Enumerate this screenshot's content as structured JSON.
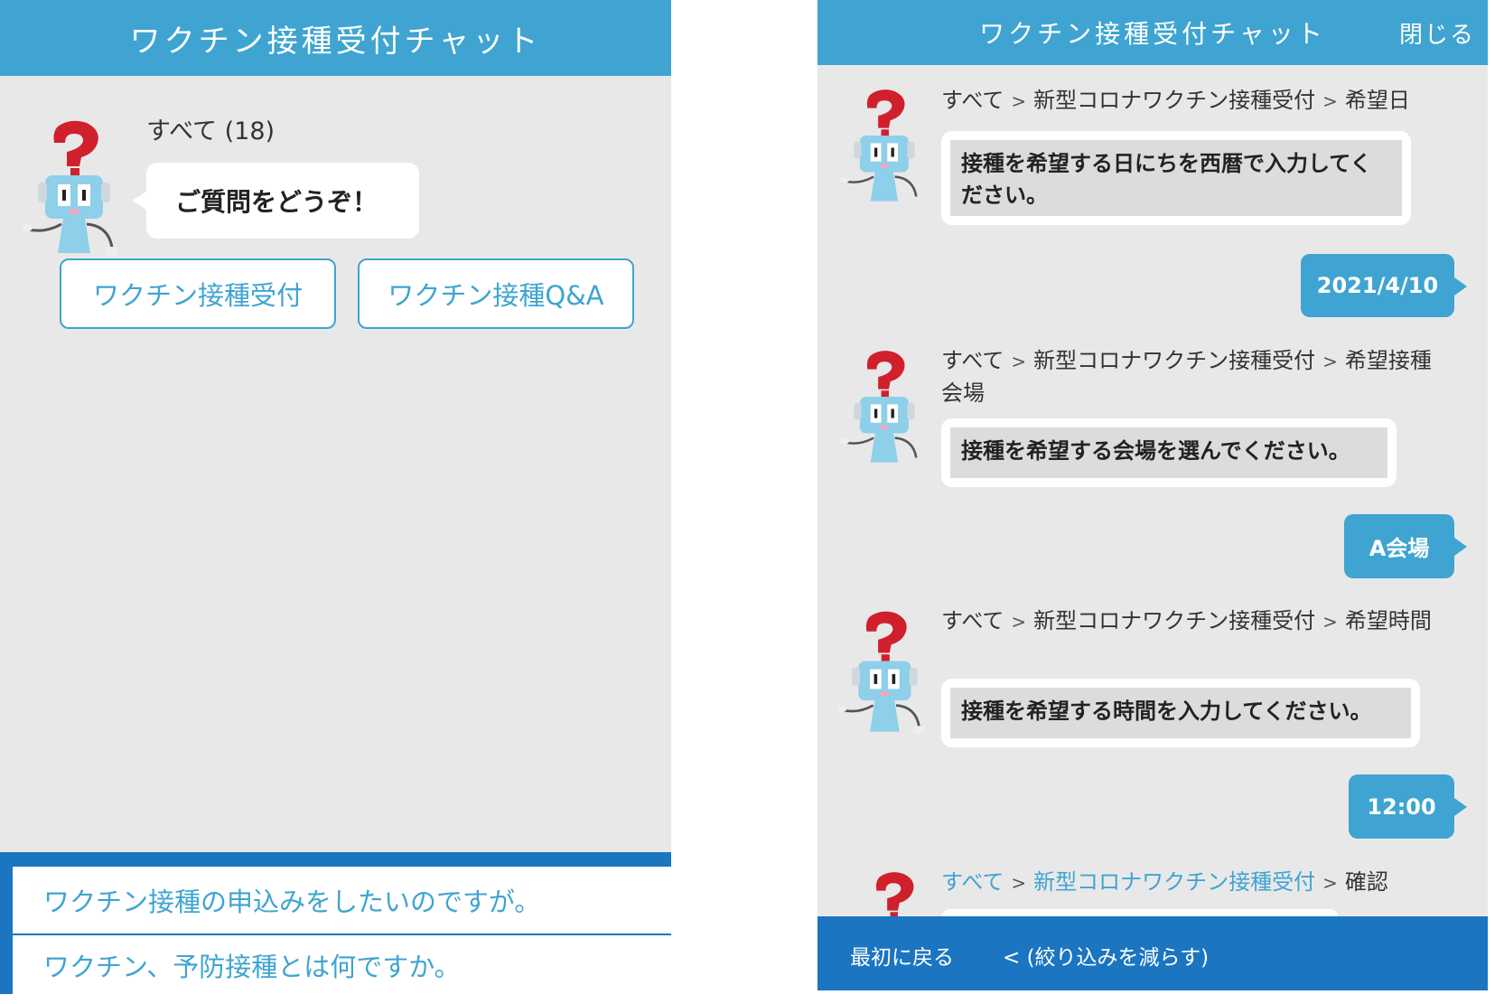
{
  "left": {
    "title": "ワクチン接種受付チャット",
    "category_label": "すべて (18)",
    "bot_greeting": "ご質問をどうぞ！",
    "buttons": [
      "ワクチン接種受付",
      "ワクチン接種Q&A"
    ],
    "suggestions": [
      "ワクチン接種の申込みをしたいのですが。",
      "ワクチン、予防接種とは何ですか。"
    ]
  },
  "right": {
    "title": "ワクチン接種受付チャット",
    "close_label": "閉じる",
    "crumb_separator": ">",
    "crumb_root": "すべて",
    "crumb_category": "新型コロナワクチン接種受付",
    "messages": [
      {
        "crumb_last": "希望日",
        "text": "接種を希望する日にちを西暦で入力してください。",
        "reply": "2021/4/10"
      },
      {
        "crumb_last": "希望接種会場",
        "text": "接種を希望する会場を選んでください。",
        "reply": "A会場"
      },
      {
        "crumb_last": "希望時間",
        "text": "接種を希望する時間を入力してください。",
        "reply": "12:00"
      },
      {
        "crumb_last": "確認"
      }
    ],
    "footer": {
      "back_to_start": "最初に戻る",
      "narrow_less": "< (絞り込みを減らす)"
    }
  },
  "colors": {
    "header_blue": "#3fa4d1",
    "footer_blue": "#1b75c0",
    "panel_bg": "#e9e8e9",
    "mascot_red": "#d0202c",
    "mascot_blue": "#8ecfea"
  },
  "icons": [
    "mascot-icon"
  ]
}
